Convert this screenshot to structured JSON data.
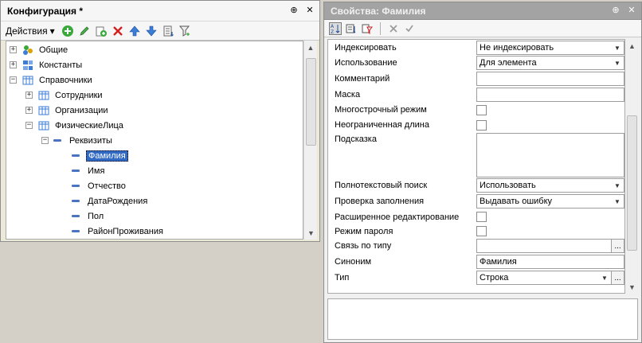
{
  "left_panel": {
    "title": "Конфигурация *",
    "pin_glyph": "⊕",
    "close_glyph": "✕",
    "toolbar": {
      "actions_label": "Действия",
      "actions_arrow": "▾",
      "buttons": [
        "add-icon",
        "edit-icon",
        "copy-icon",
        "delete-icon",
        "move-up-icon",
        "move-down-icon",
        "sort-icon",
        "filter-icon"
      ]
    },
    "tree": [
      {
        "label": "Общие",
        "expander": "+",
        "level": 0
      },
      {
        "label": "Константы",
        "expander": "+",
        "level": 0
      },
      {
        "label": "Справочники",
        "expander": "−",
        "level": 0
      },
      {
        "label": "Сотрудники",
        "expander": "+",
        "level": 1
      },
      {
        "label": "Организации",
        "expander": "+",
        "level": 1
      },
      {
        "label": "ФизическиеЛица",
        "expander": "−",
        "level": 1
      },
      {
        "label": "Реквизиты",
        "expander": "−",
        "level": 2
      },
      {
        "label": "Фамилия",
        "level": 3,
        "selected": true
      },
      {
        "label": "Имя",
        "level": 3
      },
      {
        "label": "Отчество",
        "level": 3
      },
      {
        "label": "ДатаРождения",
        "level": 3
      },
      {
        "label": "Пол",
        "level": 3
      },
      {
        "label": "РайонПроживания",
        "level": 3
      }
    ]
  },
  "right_panel": {
    "title": "Свойства: Фамилия",
    "pin_glyph": "⊕",
    "close_glyph": "✕",
    "properties": [
      {
        "label": "Индексировать",
        "value": "Не индексировать",
        "kind": "select"
      },
      {
        "label": "Использование",
        "value": "Для элемента",
        "kind": "select"
      },
      {
        "label": "Комментарий",
        "value": "",
        "kind": "text"
      },
      {
        "label": "Маска",
        "value": "",
        "kind": "text"
      },
      {
        "label": "Многострочный режим",
        "kind": "checkbox"
      },
      {
        "label": "Неограниченная длина",
        "kind": "checkbox"
      },
      {
        "label": "Подсказка",
        "value": "",
        "kind": "textarea"
      },
      {
        "label": "Полнотекстовый поиск",
        "value": "Использовать",
        "kind": "select"
      },
      {
        "label": "Проверка заполнения",
        "value": "Выдавать ошибку",
        "kind": "select"
      },
      {
        "label": "Расширенное редактирование",
        "kind": "checkbox"
      },
      {
        "label": "Режим пароля",
        "kind": "checkbox"
      },
      {
        "label": "Связь по типу",
        "value": "",
        "kind": "button"
      },
      {
        "label": "Синоним",
        "value": "Фамилия",
        "kind": "text"
      },
      {
        "label": "Тип",
        "value": "Строка",
        "kind": "select-button"
      }
    ],
    "dots_label": "...",
    "dropdown_arrow": "▼"
  },
  "colors": {
    "selection": "#316ac5",
    "inactive_title": "#a3a3a3"
  }
}
